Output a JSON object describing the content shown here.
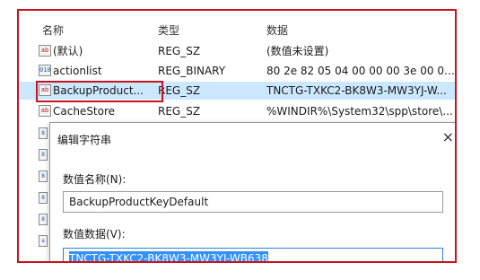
{
  "columns": {
    "name": "名称",
    "type": "类型",
    "data": "数据"
  },
  "rows": [
    {
      "icon": "ab",
      "name": "(默认)",
      "type": "REG_SZ",
      "data": "(数值未设置)"
    },
    {
      "icon": "011\n110",
      "name": "actionlist",
      "type": "REG_BINARY",
      "data": "80 2e 82 05 04 00 00 00 3e 00 00 ..."
    },
    {
      "icon": "ab",
      "name": "BackupProduct...",
      "type": "REG_SZ",
      "data": "TNCTG-TXKC2-BK8W3-MW3YJ-W..."
    },
    {
      "icon": "ab",
      "name": "CacheStore",
      "type": "REG_SZ",
      "data": "%WINDIR%\\System32\\spp\\store\\..."
    }
  ],
  "dialog": {
    "title": "编辑字符串",
    "close": "×",
    "value_name_label": "数值名称(N):",
    "value_name": "BackupProductKeyDefault",
    "value_data_label": "数值数据(V):",
    "value_data": "TNCTG-TXKC2-BK8W3-MW3YJ-WB638"
  },
  "colors": {
    "highlight": "#c8141e",
    "selected_row": "#cce8ff",
    "selection": "#3390ff"
  }
}
